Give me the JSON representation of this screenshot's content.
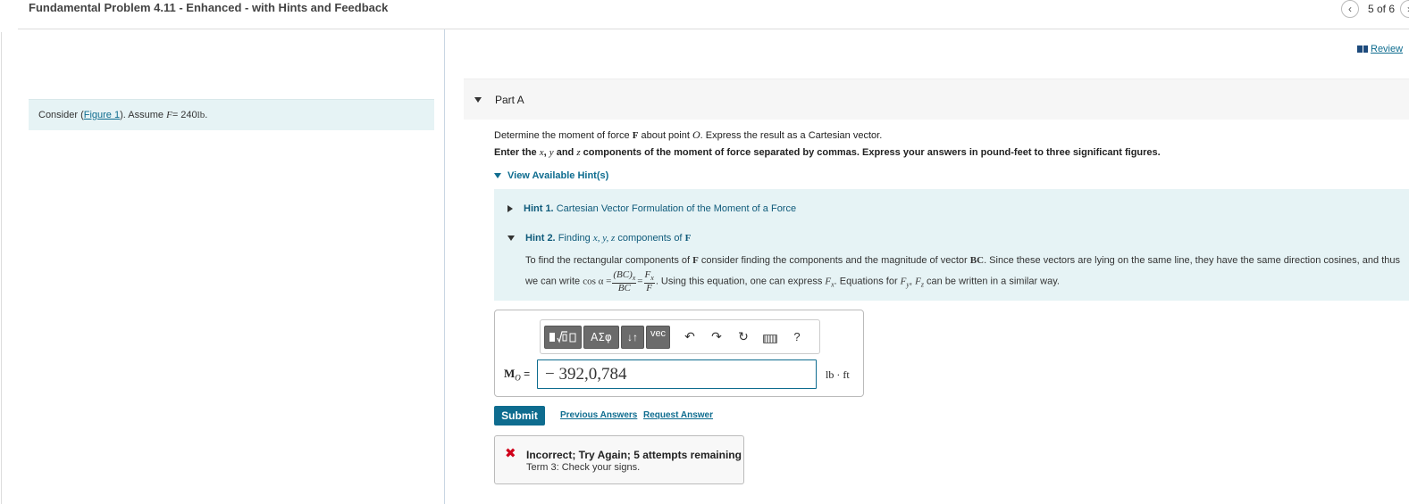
{
  "header": {
    "title": "Fundamental Problem 4.11 - Enhanced - with Hints and Feedback",
    "page_counter": "5 of 6"
  },
  "review": {
    "label": "Review"
  },
  "problem": {
    "prefix": "Consider (",
    "figure_link": "Figure 1",
    "suffix": "). Assume",
    "var": "F",
    "eq": " = 240 ",
    "unit": "lb",
    "end": "."
  },
  "part": {
    "label": "Part A"
  },
  "question": {
    "line1_a": "Determine the moment of force ",
    "line1_F": "F",
    "line1_b": " about point ",
    "line1_O": "O",
    "line1_c": ". Express the result as a Cartesian vector.",
    "line2_a": "Enter the ",
    "line2_x": "x",
    "line2_sep1": ", ",
    "line2_y": "y",
    "line2_and": " and ",
    "line2_z": "z",
    "line2_b": " components of the moment of force separated by commas. Express your answers in pound-feet to three significant figures."
  },
  "hints": {
    "toggle_label": "View Available Hint(s)",
    "hint1": {
      "num": "Hint 1.",
      "title": "Cartesian Vector Formulation of the Moment of a Force"
    },
    "hint2": {
      "num": "Hint 2.",
      "title_a": "Finding ",
      "title_vars": "x, y, z",
      "title_b": " components of ",
      "title_F": "F",
      "body_a": "To find the rectangular components of ",
      "body_F": "F",
      "body_b": " consider finding the components and the magnitude of vector ",
      "body_BC": "BC",
      "body_c": ". Since these vectors are lying on the same line, they have the same direction cosines, and thus",
      "body_d": "we can write ",
      "body_cos": "cos α =",
      "frac1_num": "(BC)",
      "frac1_sub": "x",
      "frac1_den": "BC",
      "eq": "=",
      "frac2_num": "F",
      "frac2_sub": "x",
      "frac2_den": "F",
      "body_e": ". Using this equation, one can express ",
      "body_Fx": "F",
      "body_Fx_sub": "x",
      "body_f": ". Equations for ",
      "body_Fy": "F",
      "body_Fy_sub": "y",
      "body_comma": ", ",
      "body_Fz": "F",
      "body_Fz_sub": "z",
      "body_g": " can be written in a similar way."
    }
  },
  "answer": {
    "label_M": "M",
    "label_O": "O",
    "label_eq": " =",
    "value": "− 392,0,784",
    "unit": "lb · ft",
    "toolbar": {
      "greek": "ΑΣφ",
      "arrows": "↓↑",
      "vec": "vec",
      "undo": "↶",
      "redo": "↷",
      "reset": "↻",
      "help": "?"
    }
  },
  "actions": {
    "submit": "Submit",
    "previous_answers": "Previous Answers",
    "request_answer": "Request Answer"
  },
  "feedback": {
    "icon": "✖",
    "title": "Incorrect; Try Again; 5 attempts remaining",
    "detail": "Term 3: Check your signs."
  },
  "colors": {
    "accent": "#0e6c8f",
    "hint_bg": "#e6f3f5",
    "error": "#d0021b"
  }
}
